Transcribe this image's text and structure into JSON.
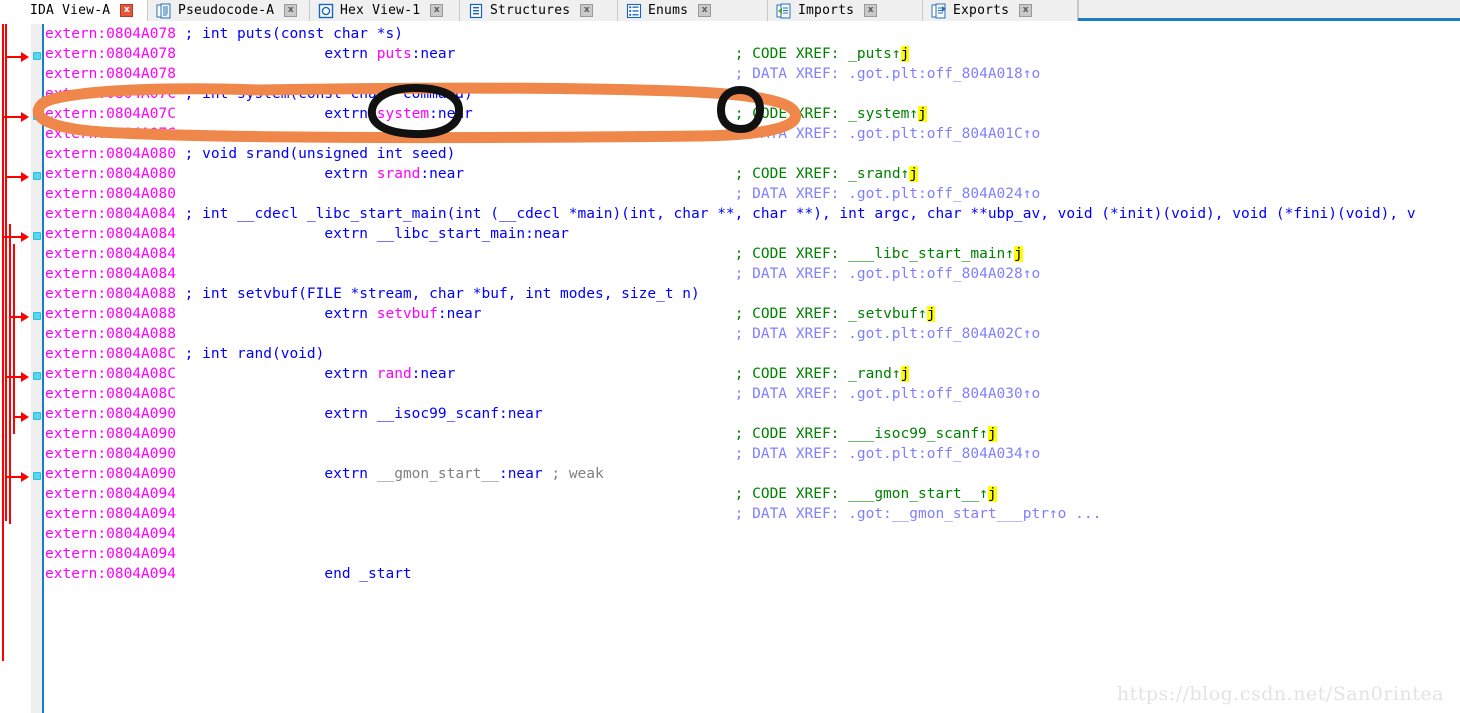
{
  "window": {
    "title": "IDA View-A",
    "accent_color": "#1a7dc4",
    "background": "#ffffff"
  },
  "tabs": [
    {
      "label": "IDA View-A",
      "icon": "none-icon",
      "active": true,
      "close_label": "x"
    },
    {
      "label": "Pseudocode-A",
      "icon": "document-icon",
      "active": false,
      "close_label": "x"
    },
    {
      "label": "Hex View-1",
      "icon": "hexview-icon",
      "active": false,
      "close_label": "x"
    },
    {
      "label": "Structures",
      "icon": "structures-icon",
      "active": false,
      "close_label": "x"
    },
    {
      "label": "Enums",
      "icon": "enums-icon",
      "active": false,
      "close_label": "x"
    },
    {
      "label": "Imports",
      "icon": "imports-icon",
      "active": false,
      "close_label": "x"
    },
    {
      "label": "Exports",
      "icon": "exports-icon",
      "active": false,
      "close_label": "x"
    }
  ],
  "disassembly": {
    "segment": "extern",
    "lines": [
      {
        "addr": "extern:0804A078",
        "kind": "proto",
        "text": " ; int puts(const char *s)"
      },
      {
        "addr": "extern:0804A078",
        "kind": "extrn",
        "indent": 17,
        "name": "puts",
        "name_color": "magenta",
        "xref_type": "CODE",
        "xref": "_puts",
        "xref_suffix": "↑",
        "xref_hl": "j",
        "xref_col": 64
      },
      {
        "addr": "extern:0804A078",
        "kind": "xrefd",
        "xref_type": "DATA",
        "xref": ".got.plt:off_804A018↑o",
        "xref_col": 64
      },
      {
        "addr": "extern:0804A07C",
        "kind": "proto",
        "text": " ; int system(const char *command)"
      },
      {
        "addr": "extern:0804A07C",
        "kind": "extrn",
        "indent": 17,
        "name": "system",
        "name_color": "magenta",
        "xref_type": "CODE",
        "xref": "_system",
        "xref_suffix": "↑",
        "xref_hl": "j",
        "xref_col": 64
      },
      {
        "addr": "extern:0804A07C",
        "kind": "xrefd",
        "xref_type": "DATA",
        "xref": ".got.plt:off_804A01C↑o",
        "xref_col": 64
      },
      {
        "addr": "extern:0804A080",
        "kind": "proto",
        "text": " ; void srand(unsigned int seed)"
      },
      {
        "addr": "extern:0804A080",
        "kind": "extrn",
        "indent": 17,
        "name": "srand",
        "name_color": "magenta",
        "xref_type": "CODE",
        "xref": "_srand",
        "xref_suffix": "↑",
        "xref_hl": "j",
        "xref_col": 64
      },
      {
        "addr": "extern:0804A080",
        "kind": "xrefd",
        "xref_type": "DATA",
        "xref": ".got.plt:off_804A024↑o",
        "xref_col": 64
      },
      {
        "addr": "extern:0804A084",
        "kind": "proto",
        "text": " ; int __cdecl _libc_start_main(int (__cdecl *main)(int, char **, char **), int argc, char **ubp_av, void (*init)(void), void (*fini)(void), v"
      },
      {
        "addr": "extern:0804A084",
        "kind": "extrn",
        "indent": 17,
        "name": "__libc_start_main",
        "name_color": "blue",
        "xref_type": null
      },
      {
        "addr": "extern:0804A084",
        "kind": "xrefc",
        "xref_type": "CODE",
        "xref": "___libc_start_main",
        "xref_suffix": "↑",
        "xref_hl": "j",
        "xref_col": 64
      },
      {
        "addr": "extern:0804A084",
        "kind": "xrefd",
        "xref_type": "DATA",
        "xref": ".got.plt:off_804A028↑o",
        "xref_col": 64
      },
      {
        "addr": "extern:0804A088",
        "kind": "proto",
        "text": " ; int setvbuf(FILE *stream, char *buf, int modes, size_t n)"
      },
      {
        "addr": "extern:0804A088",
        "kind": "extrn",
        "indent": 17,
        "name": "setvbuf",
        "name_color": "magenta",
        "xref_type": "CODE",
        "xref": "_setvbuf",
        "xref_suffix": "↑",
        "xref_hl": "j",
        "xref_col": 64
      },
      {
        "addr": "extern:0804A088",
        "kind": "xrefd",
        "xref_type": "DATA",
        "xref": ".got.plt:off_804A02C↑o",
        "xref_col": 64
      },
      {
        "addr": "extern:0804A08C",
        "kind": "proto",
        "text": " ; int rand(void)"
      },
      {
        "addr": "extern:0804A08C",
        "kind": "extrn",
        "indent": 17,
        "name": "rand",
        "name_color": "magenta",
        "xref_type": "CODE",
        "xref": "_rand",
        "xref_suffix": "↑",
        "xref_hl": "j",
        "xref_col": 64
      },
      {
        "addr": "extern:0804A08C",
        "kind": "xrefd",
        "xref_type": "DATA",
        "xref": ".got.plt:off_804A030↑o",
        "xref_col": 64
      },
      {
        "addr": "extern:0804A090",
        "kind": "extrn",
        "indent": 17,
        "name": "__isoc99_scanf",
        "name_color": "blue",
        "xref_type": null
      },
      {
        "addr": "extern:0804A090",
        "kind": "xrefc",
        "xref_type": "CODE",
        "xref": "___isoc99_scanf",
        "xref_suffix": "↑",
        "xref_hl": "j",
        "xref_col": 64
      },
      {
        "addr": "extern:0804A090",
        "kind": "xrefd",
        "xref_type": "DATA",
        "xref": ".got.plt:off_804A034↑o",
        "xref_col": 64
      },
      {
        "addr": "extern:0804A090",
        "kind": "extrnweak",
        "indent": 17,
        "name": "__gmon_start__",
        "name_color": "weak",
        "weak_tag": " ; weak"
      },
      {
        "addr": "extern:0804A094",
        "kind": "xrefc",
        "xref_type": "CODE",
        "xref": "___gmon_start__",
        "xref_suffix": "↑",
        "xref_hl": "j",
        "xref_col": 64
      },
      {
        "addr": "extern:0804A094",
        "kind": "xrefd",
        "xref_type": "DATA",
        "xref": ".got:__gmon_start___ptr↑o ...",
        "xref_col": 64
      },
      {
        "addr": "extern:0804A094",
        "kind": "blank"
      },
      {
        "addr": "extern:0804A094",
        "kind": "blank"
      },
      {
        "addr": "extern:0804A094",
        "kind": "end",
        "indent": 17,
        "text": "end _start"
      }
    ]
  },
  "annotations": {
    "orange_ellipse": {
      "color": "#f0874a",
      "label": "orange-highlight-ellipse-system-line"
    },
    "black_circle_1": {
      "color": "#000000",
      "label": "black-circle-system-symbol"
    },
    "black_circle_2": {
      "color": "#000000",
      "label": "black-circle-xref-jump-marker"
    }
  },
  "watermark": {
    "text": "https://blog.csdn.net/San0rintea"
  }
}
